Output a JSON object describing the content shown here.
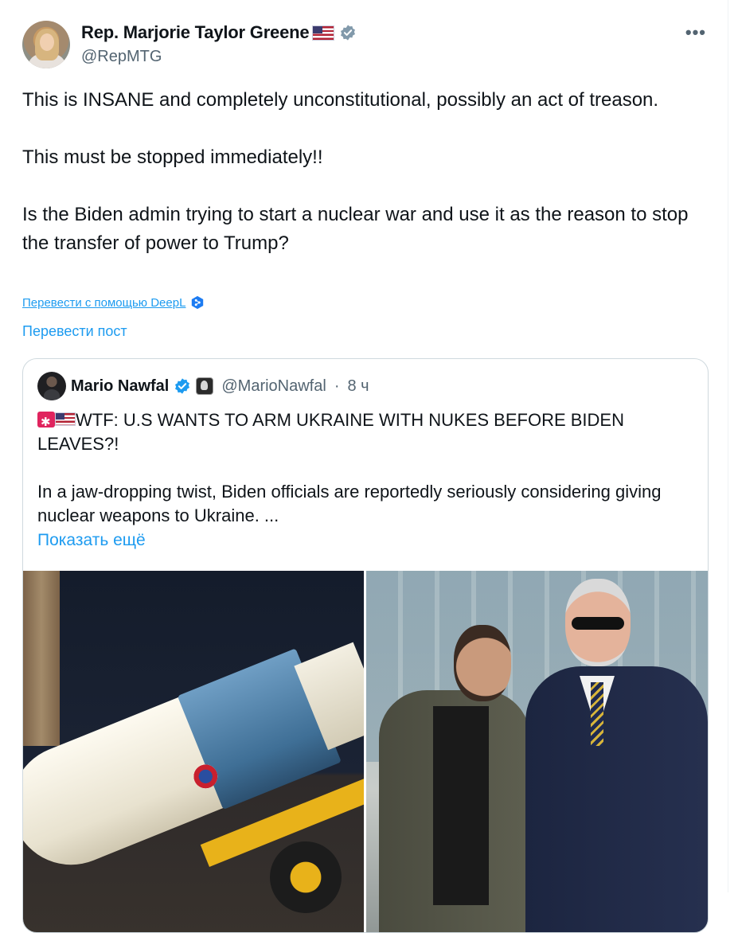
{
  "author": {
    "name": "Rep. Marjorie Taylor Greene",
    "handle": "@RepMTG"
  },
  "post": {
    "paragraphs": [
      "This is INSANE and completely unconstitutional, possibly an act of treason.",
      "This must be stopped immediately!!",
      "Is the Biden admin trying to start a nuclear war and use it as the reason to stop the transfer of power to Trump?"
    ]
  },
  "actions": {
    "more_label": "•••",
    "deepl_link": "Перевести с помощью DeepL",
    "translate_post": "Перевести пост"
  },
  "quote": {
    "name": "Mario Nawfal",
    "handle": "@MarioNawfal",
    "separator": "·",
    "time": "8 ч",
    "headline": "WTF: U.S WANTS TO ARM UKRAINE WITH NUKES BEFORE BIDEN LEAVES?!",
    "body": "In a jaw-dropping twist,  Biden officials are reportedly seriously considering giving nuclear weapons to Ukraine. ...",
    "show_more": "Показать ещё"
  },
  "colors": {
    "accent": "#1d9bf0",
    "text": "#0f1419",
    "secondary": "#536471",
    "border": "#cfd9de",
    "gov_badge": "#829aab"
  },
  "icons": [
    "avatar",
    "us-flag-icon",
    "gov-verified-icon",
    "more-icon",
    "deepl-icon",
    "verified-icon",
    "affiliate-badge-icon",
    "siren-icon"
  ]
}
